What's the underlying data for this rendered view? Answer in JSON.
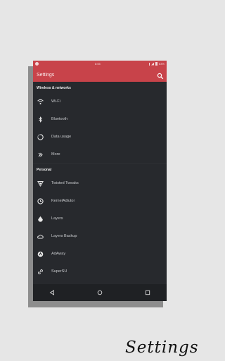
{
  "status_bar": {
    "time": "8:05",
    "battery": "63%"
  },
  "app_bar": {
    "title": "Settings",
    "search_icon": "search-icon"
  },
  "groups": [
    {
      "header": "Wireless & networks",
      "items": [
        {
          "label": "Wi-Fi",
          "icon": "wifi-icon"
        },
        {
          "label": "Bluetooth",
          "icon": "bluetooth-icon"
        },
        {
          "label": "Data usage",
          "icon": "data-usage-icon"
        },
        {
          "label": "More",
          "icon": "more-icon"
        }
      ]
    },
    {
      "header": "Personal",
      "items": [
        {
          "label": "Twisted Tweaks",
          "icon": "twisted-tweaks-icon"
        },
        {
          "label": "KernelAdiutor",
          "icon": "kernel-adiutor-icon"
        },
        {
          "label": "Layers",
          "icon": "layers-icon"
        },
        {
          "label": "Layers Backup",
          "icon": "layers-backup-icon"
        },
        {
          "label": "AdAway",
          "icon": "adaway-icon"
        },
        {
          "label": "SuperSU",
          "icon": "supersu-icon"
        }
      ]
    }
  ],
  "nav_bar": {
    "back": "back-icon",
    "home": "home-icon",
    "recents": "recents-icon"
  },
  "caption": "Settings",
  "colors": {
    "accent": "#c8434a",
    "background": "#2d2f33",
    "page": "#e6e6e6"
  }
}
